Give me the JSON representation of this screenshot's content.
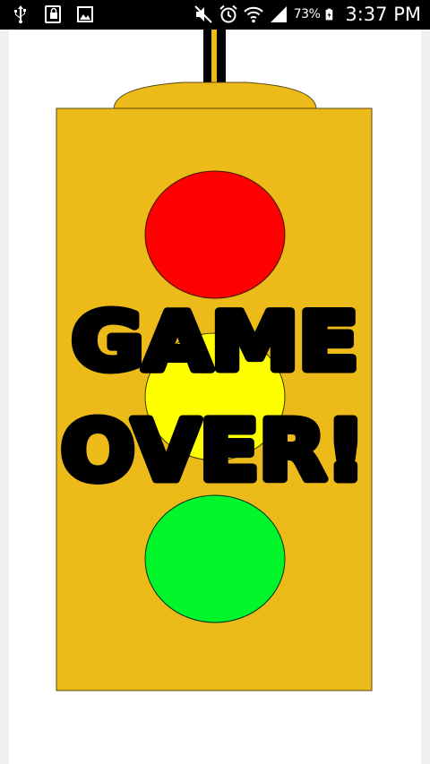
{
  "status_bar": {
    "battery_percent": "73%",
    "time": "3:37 PM",
    "icons": [
      "usb-icon",
      "lock-icon",
      "image-icon",
      "mute-icon",
      "alarm-icon",
      "wifi-icon",
      "signal-icon",
      "battery-icon"
    ]
  },
  "game": {
    "message_line1": "GAME",
    "message_line2": "OVER!",
    "colors": {
      "housing": "#EDBB19",
      "red_light": "#FF0000",
      "yellow_light": "#FFFF00",
      "green_light": "#00F52A",
      "pole": "#000000"
    }
  }
}
